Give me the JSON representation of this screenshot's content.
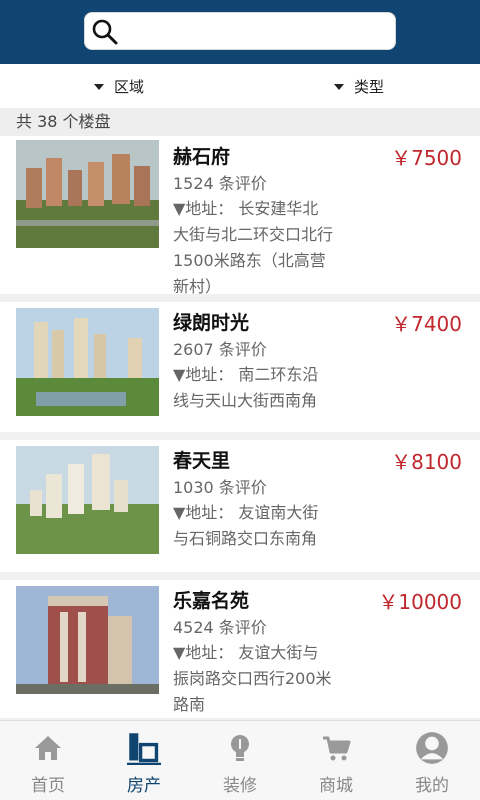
{
  "search": {
    "placeholder": ""
  },
  "filters": {
    "area": "区域",
    "type": "类型"
  },
  "count": "共 38 个楼盘",
  "listings": [
    {
      "name": "赫石府",
      "price": "￥7500",
      "reviews": "1524 条评价",
      "address": "▼地址： 长安建华北大街与北二环交口北行1500米路东（北高营新村）"
    },
    {
      "name": "绿朗时光",
      "price": "￥7400",
      "reviews": "2607 条评价",
      "address": "▼地址： 南二环东沿线与天山大街西南角"
    },
    {
      "name": "春天里",
      "price": "￥8100",
      "reviews": "1030 条评价",
      "address": "▼地址： 友谊南大街与石铜路交口东南角"
    },
    {
      "name": "乐嘉名苑",
      "price": "￥10000",
      "reviews": "4524 条评价",
      "address": "▼地址： 友谊大街与振岗路交口西行200米路南"
    }
  ],
  "tabs": [
    {
      "label": "首页",
      "icon": "home-icon"
    },
    {
      "label": "房产",
      "icon": "building-icon"
    },
    {
      "label": "装修",
      "icon": "lightbulb-icon"
    },
    {
      "label": "商城",
      "icon": "cart-icon"
    },
    {
      "label": "我的",
      "icon": "user-icon"
    }
  ],
  "colors": {
    "header": "#0f4570",
    "price": "#c0282e",
    "active_tab": "#0f4570",
    "inactive_tab": "#888888"
  }
}
